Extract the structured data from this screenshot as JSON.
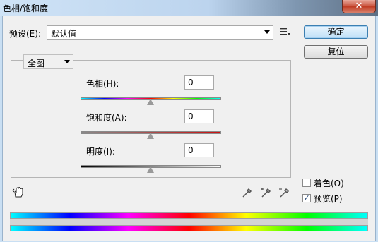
{
  "window": {
    "title": "色相/饱和度",
    "close_label": "✕"
  },
  "preset": {
    "label": "预设(E):",
    "value": "默认值",
    "menu_icon": "list-menu-icon"
  },
  "buttons": {
    "ok": "确定",
    "reset": "复位"
  },
  "channel": {
    "value": "全图"
  },
  "hue": {
    "label": "色相(H):",
    "value": "0",
    "level": 0
  },
  "saturation": {
    "label": "饱和度(A):",
    "value": "0",
    "level": 0
  },
  "lightness": {
    "label": "明度(I):",
    "value": "0",
    "level": 0
  },
  "options": {
    "colorize": {
      "label": "着色(O)",
      "checked": false
    },
    "preview": {
      "label": "预览(P)",
      "checked": true
    }
  },
  "icons": [
    "hand-adjust-icon",
    "eyedropper-icon",
    "eyedropper-plus-icon",
    "eyedropper-minus-icon"
  ]
}
